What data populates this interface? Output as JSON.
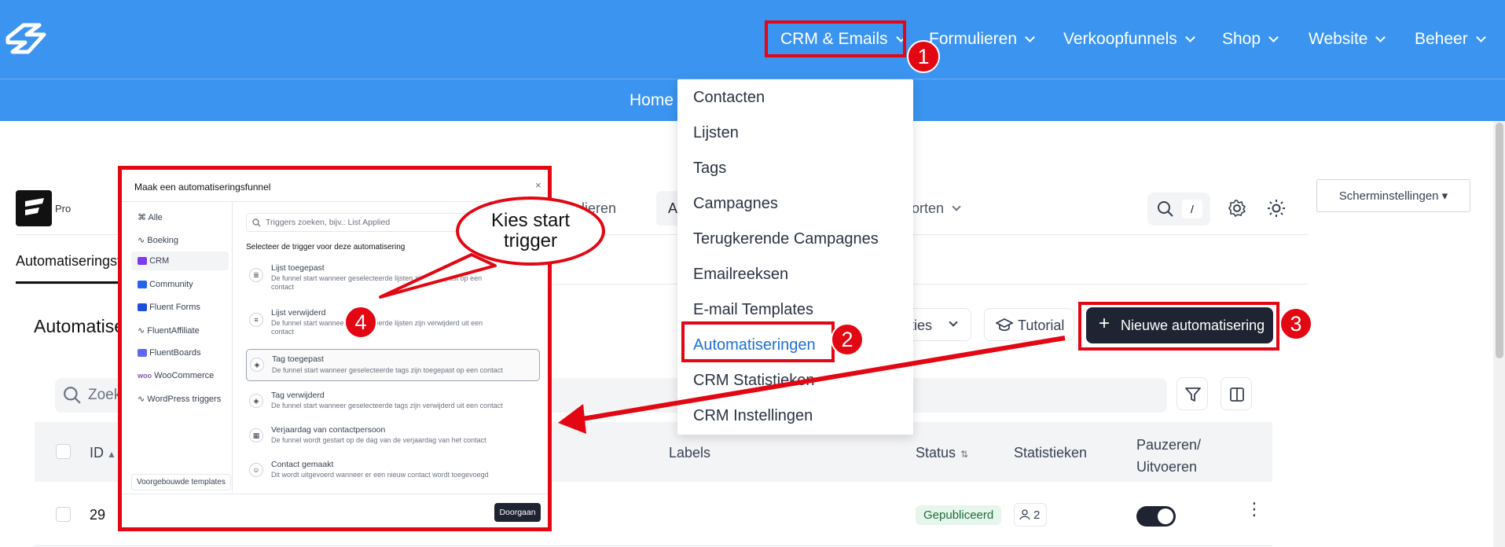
{
  "topnav": {
    "items": [
      "CRM & Emails",
      "Formulieren",
      "Verkoopfunnels",
      "Shop",
      "Website",
      "Beheer"
    ]
  },
  "subnav": {
    "home": "Home"
  },
  "dropdown": {
    "items": [
      "Contacten",
      "Lijsten",
      "Tags",
      "Campagnes",
      "Terugkerende Campagnes",
      "Emailreeksen",
      "E-mail Templates",
      "Automatiseringen",
      "CRM Statistieken",
      "CRM Instellingen"
    ]
  },
  "app": {
    "pro": "Pro",
    "tab_partial": "Automatiseringsf",
    "nav_partial_1": "ulieren",
    "nav_partial_a": "A",
    "nav_partial_2": "orten",
    "search_kbd": "/",
    "screen_settings": "Scherminstellingen ▾",
    "heading_partial": "Automatise",
    "search_partial": "Zoek",
    "acties_partial": "cties",
    "tutorial": "Tutorial",
    "new_automation": "Nieuwe automatisering"
  },
  "table": {
    "headers": {
      "id": "ID",
      "labels": "Labels",
      "status": "Status",
      "stats": "Statistieken",
      "pause_1": "Pauzeren/",
      "pause_2": "Uitvoeren"
    },
    "row": {
      "id": "29",
      "status": "Gepubliceerd",
      "stats": "2"
    }
  },
  "modal": {
    "title": "Maak een automatiseringsfunnel",
    "close": "×",
    "search_placeholder": "Triggers zoeken, bijv.: List Applied",
    "subtitle": "Selecteer de trigger voor deze automatisering",
    "categories": [
      "Alle",
      "Boeking",
      "CRM",
      "Community",
      "Fluent Forms",
      "FluentAffiliate",
      "FluentBoards",
      "WooCommerce",
      "WordPress triggers"
    ],
    "templates_button": "Voorgebouwde templates",
    "triggers": [
      {
        "title": "Lijst toegepast",
        "desc": "De funnel start wanneer geselecteerde lijsten zijn toegepast op een contact"
      },
      {
        "title": "Lijst verwijderd",
        "desc": "De funnel start wanneer geselecteerde lijsten zijn verwijderd uit een contact"
      },
      {
        "title": "Tag toegepast",
        "desc": "De funnel start wanneer geselecteerde tags zijn toegepast op een contact"
      },
      {
        "title": "Tag verwijderd",
        "desc": "De funnel start wanneer geselecteerde tags zijn verwijderd uit een contact"
      },
      {
        "title": "Verjaardag van contactpersoon",
        "desc": "De funnel wordt gestart op de dag van de verjaardag van het contact"
      },
      {
        "title": "Contact gemaakt",
        "desc": "Dit wordt uitgevoerd wanneer er een nieuw contact wordt toegevoegd"
      }
    ],
    "continue": "Doorgaan"
  },
  "annotations": {
    "bubble_line1": "Kies start",
    "bubble_line2": "trigger",
    "badges": [
      "1",
      "2",
      "3",
      "4"
    ],
    "color": "#e30613"
  },
  "colors": {
    "header": "#3b94f0",
    "primary_dark": "#1f2433",
    "link": "#1d6fd6"
  }
}
